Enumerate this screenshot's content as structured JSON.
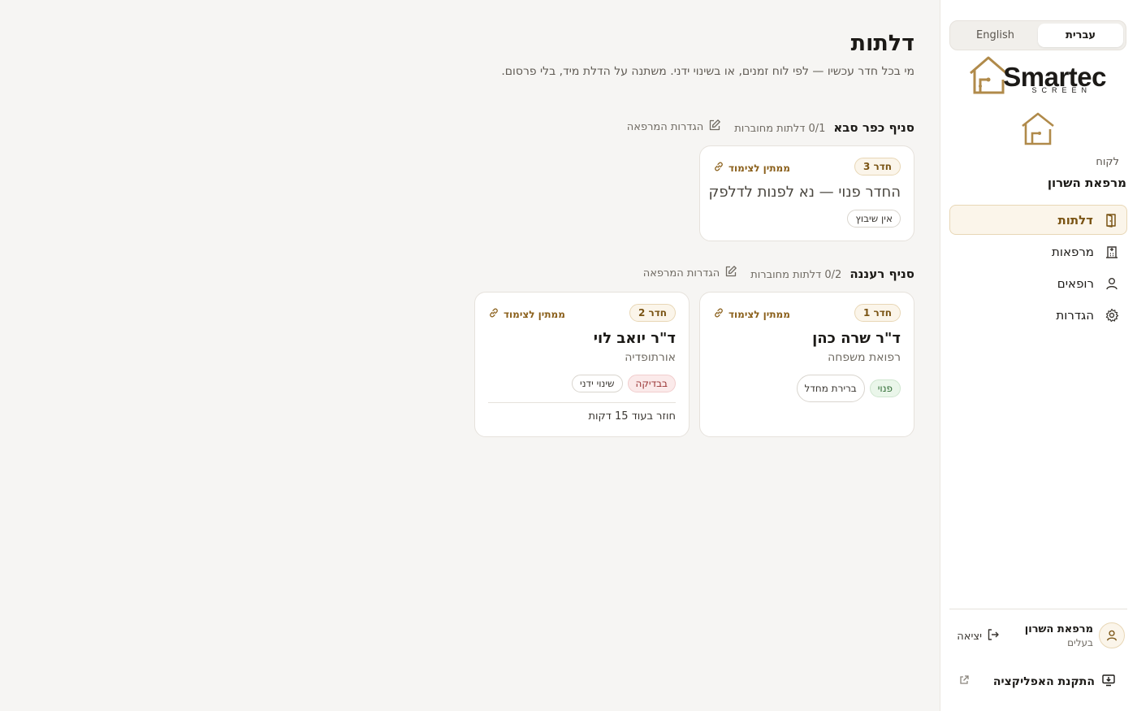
{
  "sidebar": {
    "languages": {
      "hebrew": "עברית",
      "english": "English"
    },
    "brand": {
      "name": "Smartec",
      "tagline": "SCREEN"
    },
    "client_label": "לקוח",
    "client_name": "מרפאת השרון",
    "nav": [
      {
        "label": "דלתות",
        "icon": "door-icon",
        "active": true
      },
      {
        "label": "מרפאות",
        "icon": "building-icon",
        "active": false
      },
      {
        "label": "רופאים",
        "icon": "person-icon",
        "active": false
      },
      {
        "label": "הגדרות",
        "icon": "gear-icon",
        "active": false
      }
    ],
    "user": {
      "name": "מרפאת השרון",
      "role": "בעלים"
    },
    "logout_label": "יציאה",
    "install_label": "התקנת האפליקציה"
  },
  "main": {
    "title": "דלתות",
    "subtitle": "מי בכל חדר עכשיו — לפי לוח זמנים, או בשינוי ידני. משתנה על הדלת מיד, בלי פרסום.",
    "branches": [
      {
        "name": "סניף כפר סבא",
        "count": "0/1 דלתות מחוברות",
        "settings_label": "הגדרות המרפאה",
        "rooms": [
          {
            "room": "חדר 3",
            "pair_label": "ממתין לצימוד",
            "title": "החדר פנוי — נא לפנות לדלפק",
            "chips": [
              "אין שיבוץ"
            ]
          }
        ]
      },
      {
        "name": "סניף רעננה",
        "count": "0/2 דלתות מחוברות",
        "settings_label": "הגדרות המרפאה",
        "rooms": [
          {
            "room": "חדר 1",
            "pair_label": "ממתין לצימוד",
            "title": "ד\"ר שרה כהן",
            "specialty": "רפואת משפחה",
            "chips": [
              "פנוי",
              "ברירת מחדל"
            ]
          },
          {
            "room": "חדר 2",
            "pair_label": "ממתין לצימוד",
            "title": "ד\"ר יואב לוי",
            "specialty": "אורתופדיה",
            "chips": [
              "בבדיקה",
              "שינוי ידני"
            ],
            "note": "חוזר בעוד 15 דקות"
          }
        ]
      }
    ]
  },
  "colors": {
    "accent": "#b08a4a",
    "accent_dark": "#7a5414",
    "status_free": "#2f6b33",
    "status_busy": "#9a3434"
  }
}
